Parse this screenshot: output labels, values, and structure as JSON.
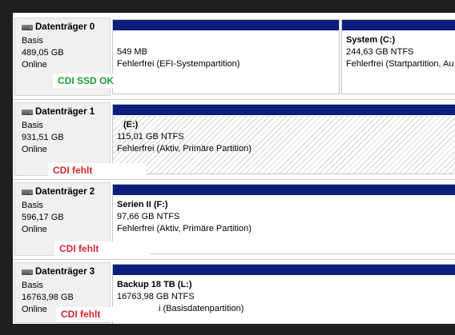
{
  "disks": [
    {
      "name": "Datenträger 0",
      "type": "Basis",
      "size": "489,05 GB",
      "status": "Online",
      "note": "CDI SSD OK",
      "partitions": [
        {
          "label": "",
          "size": "549 MB",
          "status": "Fehlerfrei (EFI-Systempartition)"
        },
        {
          "label": "System  (C:)",
          "size": "244,63 GB NTFS",
          "status": "Fehlerfrei (Startpartition, Au"
        }
      ]
    },
    {
      "name": "Datenträger 1",
      "type": "Basis",
      "size": "931,51 GB",
      "status": "Online",
      "note": "CDI fehlt",
      "partitions": [
        {
          "label": "(E:)",
          "size": "115,01 GB NTFS",
          "status": "Fehlerfrei (Aktiv, Primäre Partition)"
        }
      ]
    },
    {
      "name": "Datenträger 2",
      "type": "Basis",
      "size": "596,17 GB",
      "status": "Online",
      "note": "CDI fehlt",
      "partitions": [
        {
          "label": "Serien II  (F:)",
          "size": "97,66 GB NTFS",
          "status": "Fehlerfrei (Aktiv, Primäre Partition)"
        }
      ]
    },
    {
      "name": "Datenträger 3",
      "type": "Basis",
      "size": "16763,98 GB",
      "status": "Online",
      "note": "CDI fehlt",
      "partitions": [
        {
          "label": "Backup 18 TB  (L:)",
          "size": "16763,98 GB NTFS",
          "status": "i (Basisdatenpartition)"
        }
      ]
    }
  ],
  "colors": {
    "partition_bar": "#0a1e7c",
    "ok_note": "#1e9c3a",
    "missing_note": "#d7262f"
  },
  "icons": {
    "disk": "disk-drive-icon"
  }
}
